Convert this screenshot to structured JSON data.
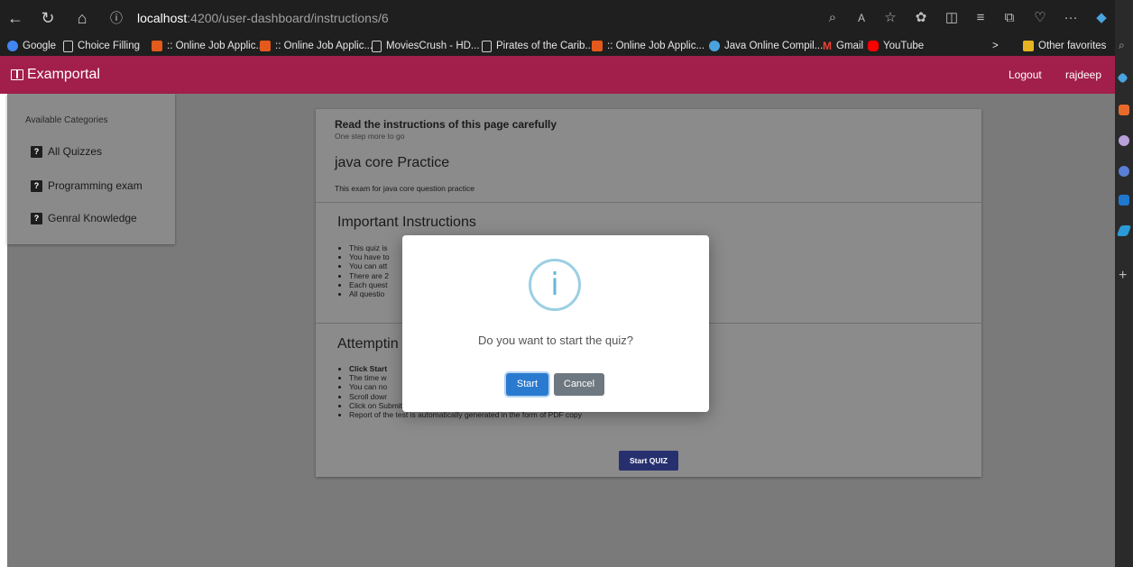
{
  "browser": {
    "url_host": "localhost",
    "url_path": ":4200/user-dashboard/instructions/6",
    "bookmarks": [
      {
        "label": "Google",
        "icon": "google-icon",
        "color": "#4285f4"
      },
      {
        "label": "Choice Filling",
        "icon": "page-icon",
        "color": "#cfcfcf"
      },
      {
        "label": ":: Online Job Applic...",
        "icon": "site-icon",
        "color": "#e35a1c"
      },
      {
        "label": ":: Online Job Applic...",
        "icon": "site-icon",
        "color": "#e35a1c"
      },
      {
        "label": "MoviesCrush - HD...",
        "icon": "page-icon",
        "color": "#cfcfcf"
      },
      {
        "label": "Pirates of the Carib...",
        "icon": "page-icon",
        "color": "#cfcfcf"
      },
      {
        "label": ":: Online Job Applic...",
        "icon": "site-icon",
        "color": "#e35a1c"
      },
      {
        "label": "Java Online Compil...",
        "icon": "globe-icon",
        "color": "#4aa3df"
      },
      {
        "label": "Gmail",
        "icon": "gmail-icon",
        "color": "#ea4335"
      },
      {
        "label": "YouTube",
        "icon": "youtube-icon",
        "color": "#ff0000"
      }
    ],
    "other_favorites": "Other favorites"
  },
  "app": {
    "brand": "Examportal",
    "logout": "Logout",
    "user": "rajdeep",
    "brand_color": "#a21f4b"
  },
  "sidebar": {
    "title": "Available Categories",
    "items": [
      "All Quizzes",
      "Programming exam",
      "Genral Knowledge"
    ]
  },
  "instructions": {
    "heading": "Read the instructions of this page carefully",
    "subheading": "One step more to go",
    "quiz_title": "java core Practice",
    "quiz_desc": "This exam for java core question practice",
    "important_title": "Important Instructions",
    "important_items": [
      "This quiz is",
      "You have to",
      "You can att",
      "There are 2",
      "Each quest",
      "All questio"
    ],
    "attempting_title": "Attemptin",
    "attempting_items": [
      "Click Start",
      "The time w",
      "You can no",
      "Scroll dowr",
      "Click on Submit Quiz button on completion of the quiz.",
      "Report of the test is automatically generated in the form of PDF copy"
    ],
    "start_quiz": "Start QUIZ"
  },
  "modal": {
    "icon": "info-icon",
    "question": "Do you want to start the quiz?",
    "confirm": "Start",
    "cancel": "Cancel"
  }
}
